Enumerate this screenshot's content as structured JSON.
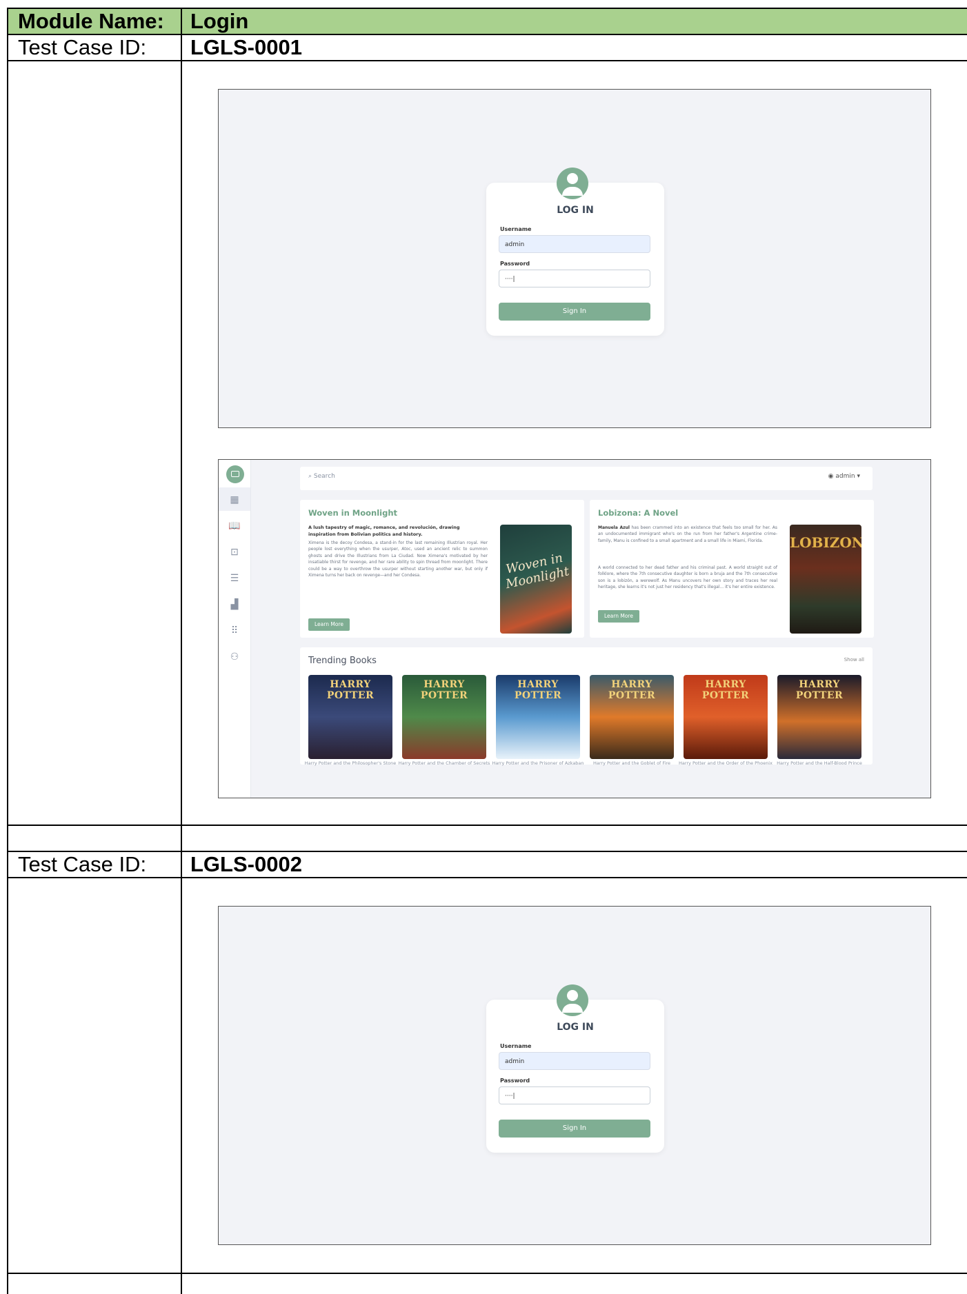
{
  "module": {
    "label": "Module Name:",
    "value": "Login"
  },
  "test_cases": [
    {
      "label": "Test Case ID:",
      "id": "LGLS-0001"
    },
    {
      "label": "Test Case ID:",
      "id": "LGLS-0002"
    }
  ],
  "login": {
    "title": "LOG IN",
    "username_label": "Username",
    "username_value": "admin",
    "password_label": "Password",
    "password_value": "····|",
    "signin_label": "Sign In"
  },
  "dashboard": {
    "search_placeholder": "Search",
    "user_name": "admin",
    "features": [
      {
        "title": "Woven in Moonlight",
        "lead": "A lush tapestry of magic, romance, and revolución, drawing inspiration from Bolivian politics and history.",
        "text": "Ximena is the decoy Condesa, a stand-in for the last remaining Illustrian royal. Her people lost everything when the usurper, Atoc, used an ancient relic to summon ghosts and drive the Illustrians from La Ciudad. Now Ximena's motivated by her insatiable thirst for revenge, and her rare ability to spin thread from moonlight. There could be a way to overthrow the usurper without starting another war, but only if Ximena turns her back on revenge—and her Condesa.",
        "button": "Learn More"
      },
      {
        "title": "Lobizona: A Novel",
        "lead": "Manuela Azul",
        "text": "has been crammed into an existence that feels too small for her. As an undocumented immigrant who's on the run from her father's Argentine crime-family, Manu is confined to a small apartment and a small life in Miami, Florida.",
        "text2": "A world connected to her dead father and his criminal past. A world straight out of folklore, where the 7th consecutive daughter is born a bruja and the 7th consecutive son is a lobizón, a werewolf. As Manu uncovers her own story and traces her real heritage, she learns it's not just her residency that's illegal... it's her entire existence.",
        "button": "Learn More"
      }
    ],
    "trending_title": "Trending Books",
    "show_all": "Show all",
    "trending": [
      {
        "caption": "Harry Potter and the Philosopher's Stone",
        "color": "#2c3a5c"
      },
      {
        "caption": "Harry Potter and the Chamber of Secrets",
        "color": "#3f7a4a"
      },
      {
        "caption": "Harry Potter and the Prisoner of Azkaban",
        "color": "#2f6a9a"
      },
      {
        "caption": "Harry Potter and the Goblet of Fire",
        "color": "#b86a2a"
      },
      {
        "caption": "Harry Potter and the Order of the Phoenix",
        "color": "#b8452a"
      },
      {
        "caption": "Harry Potter and the Half-Blood Prince",
        "color": "#3a3a4a"
      }
    ],
    "cover_title": "HARRY POTTER"
  },
  "colors": {
    "header_green": "#a9d18e",
    "accent_green": "#7fae93"
  }
}
